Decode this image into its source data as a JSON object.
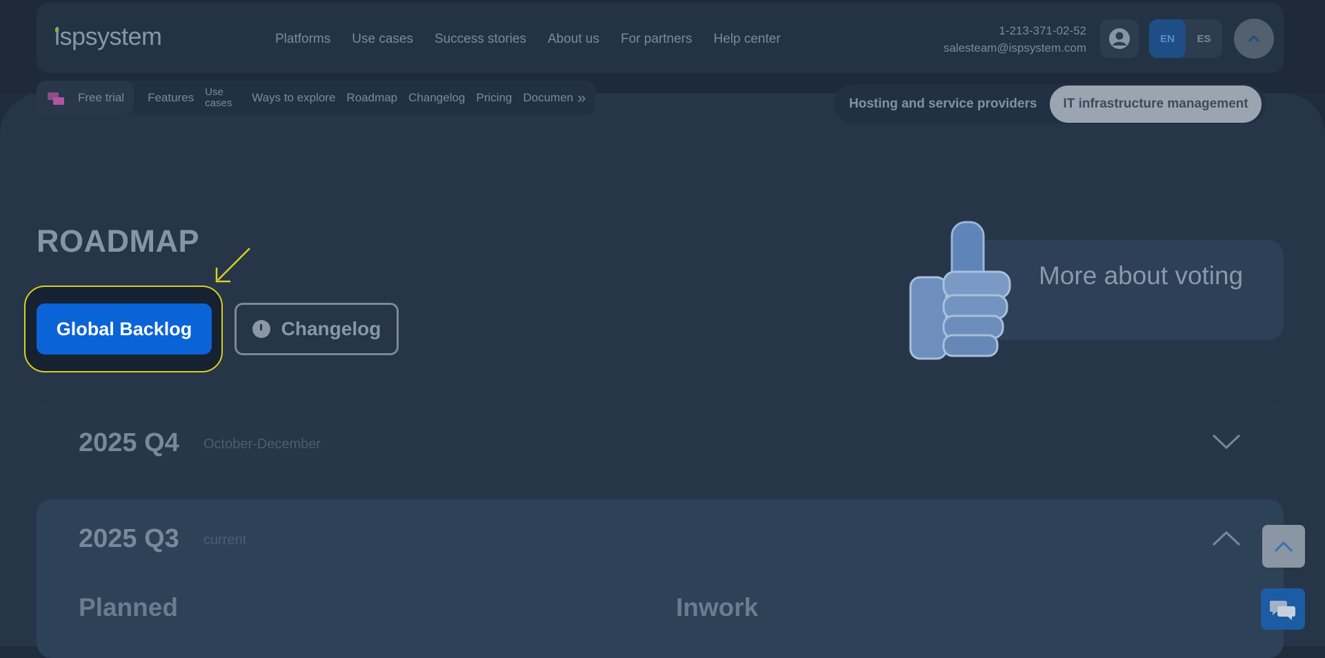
{
  "header": {
    "logo": "ispsystem",
    "nav": [
      "Platforms",
      "Use cases",
      "Success stories",
      "About us",
      "For partners",
      "Help center"
    ],
    "phone": "1-213-371-02-52",
    "email": "salesteam@ispsystem.com",
    "languages": [
      "EN",
      "ES"
    ],
    "active_language": "EN"
  },
  "subnav": {
    "trial": "Free trial",
    "features": "Features",
    "use_cases": "Use cases",
    "ways": "Ways to explore",
    "roadmap": "Roadmap",
    "changelog": "Changelog",
    "pricing": "Pricing",
    "docs": "Documen"
  },
  "segment": {
    "option_a": "Hosting and service providers",
    "option_b": "IT infrastructure management",
    "selected": "IT infrastructure management"
  },
  "page": {
    "title": "ROADMAP",
    "backlog_button": "Global Backlog",
    "changelog_button": "Changelog",
    "voting_text": "More about voting"
  },
  "quarters": [
    {
      "year": "2025 Q4",
      "subtitle": "October-December",
      "expanded": false
    },
    {
      "year": "2025 Q3",
      "subtitle": "current",
      "expanded": true
    }
  ],
  "columns": [
    "Planned",
    "Inwork"
  ],
  "colors": {
    "primary_button": "#0b63d8",
    "highlight_ring": "#d8d21f",
    "background": "#263648"
  }
}
